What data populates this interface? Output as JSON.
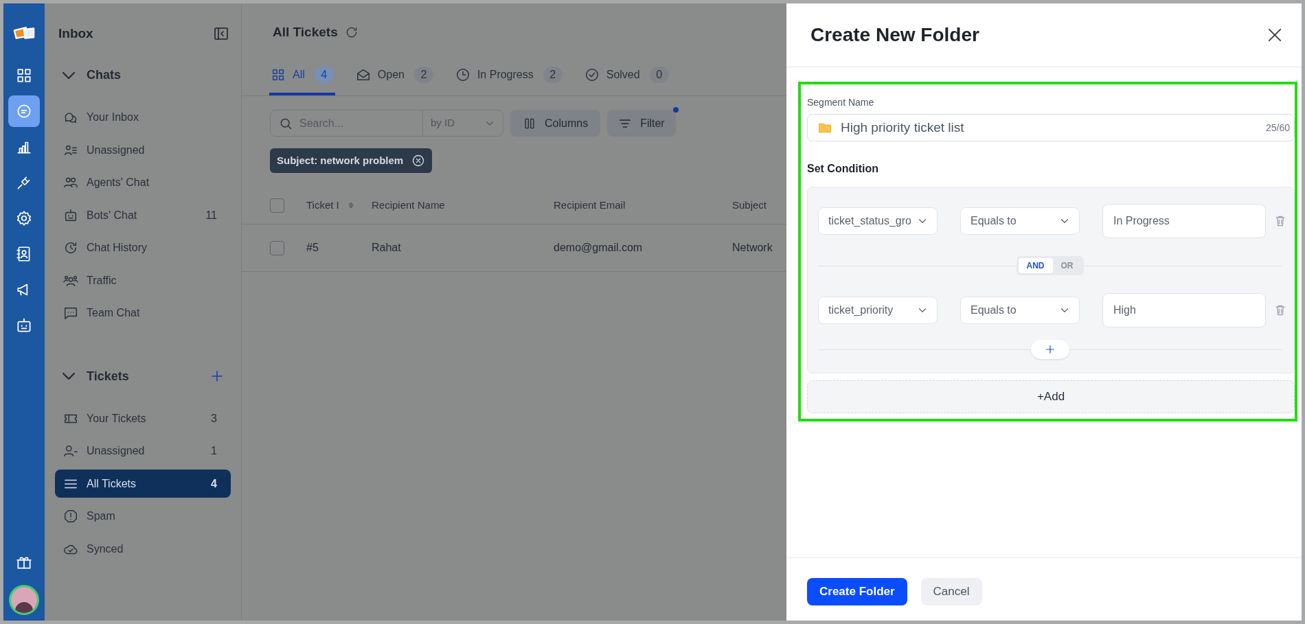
{
  "rail": {
    "items": [
      {
        "selected": false
      },
      {
        "selected": true
      },
      {
        "selected": false
      },
      {
        "selected": false
      },
      {
        "selected": false
      },
      {
        "selected": false
      },
      {
        "selected": false
      },
      {
        "selected": false
      }
    ]
  },
  "inbox": {
    "title": "Inbox",
    "sections": [
      {
        "title": "Chats",
        "expanded": true,
        "items": [
          {
            "label": "Your Inbox",
            "selected": false
          },
          {
            "label": "Unassigned",
            "selected": false
          },
          {
            "label": "Agents' Chat",
            "selected": false
          },
          {
            "label": "Bots' Chat",
            "count": "11",
            "selected": false
          },
          {
            "label": "Chat History",
            "selected": false
          },
          {
            "label": "Traffic",
            "selected": false
          },
          {
            "label": "Team Chat",
            "selected": false
          }
        ]
      },
      {
        "title": "Tickets",
        "expanded": true,
        "can_add": true,
        "items": [
          {
            "label": "Your Tickets",
            "count": "3",
            "selected": false
          },
          {
            "label": "Unassigned",
            "count": "1",
            "selected": false
          },
          {
            "label": "All Tickets",
            "count": "4",
            "selected": true
          },
          {
            "label": "Spam",
            "selected": false
          },
          {
            "label": "Synced",
            "selected": false
          }
        ]
      }
    ]
  },
  "main": {
    "title": "All Tickets",
    "tabs": [
      {
        "label": "All",
        "count": "4",
        "selected": true
      },
      {
        "label": "Open",
        "count": "2",
        "selected": false
      },
      {
        "label": "In Progress",
        "count": "2",
        "selected": false
      },
      {
        "label": "Solved",
        "count": "0",
        "selected": false
      }
    ],
    "search": {
      "placeholder": "Search...",
      "by": "by ID"
    },
    "columns_button": "Columns",
    "filter_button": {
      "label": "Filter",
      "active": true
    },
    "filter_chip": "Subject: network problem",
    "table": {
      "all_checked": false,
      "columns": [
        "Ticket I",
        "Recipient Name",
        "Recipient Email",
        "Subject"
      ],
      "rows": [
        {
          "checked": false,
          "cells": [
            "#5",
            "Rahat",
            "demo@gmail.com",
            "Network"
          ]
        }
      ]
    }
  },
  "modal": {
    "title": "Create New Folder",
    "segment_label": "Segment Name",
    "segment_value": "High priority ticket list",
    "char_count": "25/60",
    "condition_label": "Set Condition",
    "conditions": [
      {
        "field": "ticket_status_gro",
        "operator": "Equals to",
        "value": "In Progress"
      },
      {
        "field": "ticket_priority",
        "operator": "Equals to",
        "value": "High"
      }
    ],
    "joiners": [
      {
        "label": "AND",
        "selected": true
      },
      {
        "label": "OR",
        "selected": false
      }
    ],
    "add_label": "+Add",
    "buttons": [
      {
        "label": "Create Folder",
        "kind": "primary"
      },
      {
        "label": "Cancel",
        "kind": "secondary"
      }
    ]
  }
}
